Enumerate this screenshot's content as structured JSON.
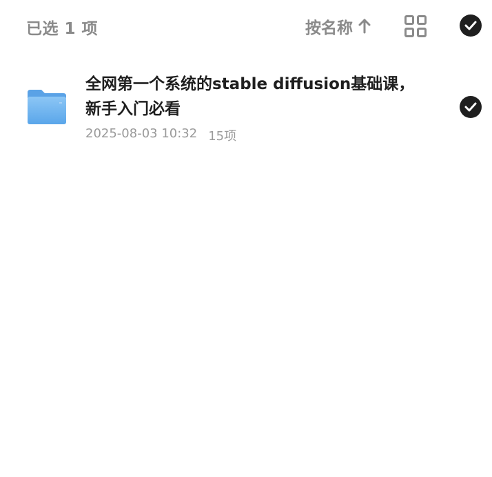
{
  "header": {
    "selected_label": "已选 1 项",
    "sort_label": "按名称",
    "sort_icon": "arrow-up-icon",
    "view_toggle_icon": "grid-view-icon",
    "select_all_icon": "check-circle-icon"
  },
  "files": [
    {
      "name": "全网第一个系统的stable diffusion基础课，新手入门必看",
      "date": "2025-08-03 10:32",
      "count": "15项",
      "type_icon": "folder-icon",
      "selected": true
    }
  ],
  "colors": {
    "muted_text": "#8a8a8a",
    "title_text": "#1f1f1f",
    "check_fill": "#1f1f1f",
    "folder_blue": "#6fb3ef"
  }
}
